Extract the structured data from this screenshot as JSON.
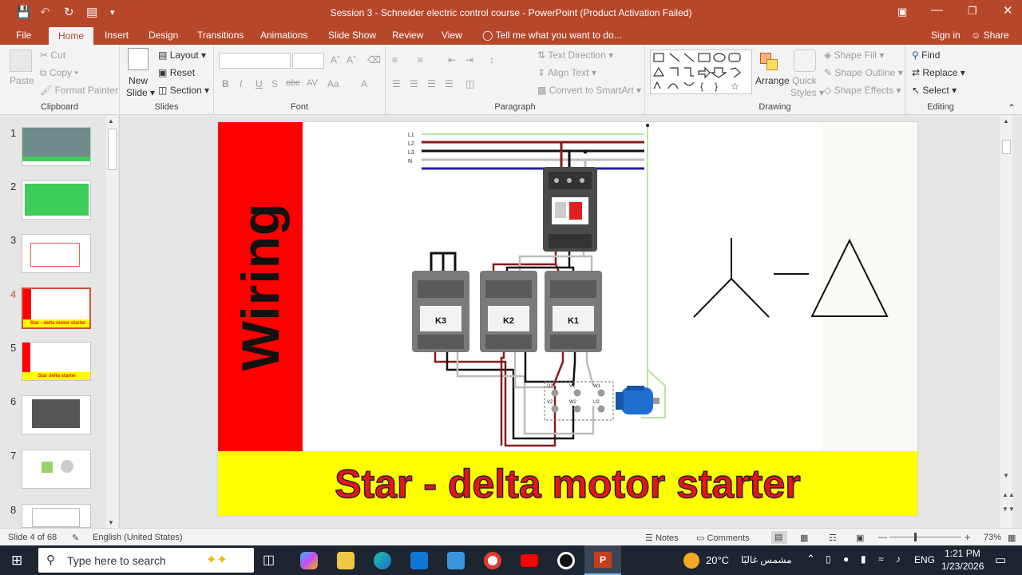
{
  "window": {
    "title": "Session 3 - Schneider electric control course - PowerPoint (Product Activation Failed)"
  },
  "tabs": [
    "File",
    "Home",
    "Insert",
    "Design",
    "Transitions",
    "Animations",
    "Slide Show",
    "Review",
    "View"
  ],
  "tell_me": "Tell me what you want to do...",
  "account": {
    "signin": "Sign in",
    "share": "Share"
  },
  "ribbon": {
    "clipboard": {
      "label": "Clipboard",
      "paste": "Paste",
      "cut": "Cut",
      "copy": "Copy",
      "format_painter": "Format Painter"
    },
    "slides": {
      "label": "Slides",
      "new_slide_1": "New",
      "new_slide_2": "Slide",
      "layout": "Layout",
      "reset": "Reset",
      "section": "Section"
    },
    "font": {
      "label": "Font",
      "bold": "B",
      "italic": "I",
      "underline": "U",
      "shadow": "S",
      "strike": "abc",
      "spacing": "AV",
      "case": "Aa",
      "color": "A"
    },
    "paragraph": {
      "label": "Paragraph",
      "text_direction": "Text Direction",
      "align_text": "Align Text",
      "convert_smartart": "Convert to SmartArt"
    },
    "drawing": {
      "label": "Drawing",
      "arrange": "Arrange",
      "quick_styles_1": "Quick",
      "quick_styles_2": "Styles",
      "shape_fill": "Shape Fill",
      "shape_outline": "Shape Outline",
      "shape_effects": "Shape Effects"
    },
    "editing": {
      "label": "Editing",
      "find": "Find",
      "replace": "Replace",
      "select": "Select"
    }
  },
  "thumbnails": {
    "numbers": [
      "1",
      "2",
      "3",
      "4",
      "5",
      "6",
      "7",
      "8"
    ],
    "selected": "4",
    "slide4_caption": "Star - delta motor starter",
    "slide5_caption": "Star delta starter"
  },
  "slide": {
    "side_label": "Wiring",
    "banner": "Star - delta motor starter",
    "lines": [
      "L1",
      "L2",
      "L3",
      "N"
    ],
    "contactors": [
      "K3",
      "K2",
      "K1"
    ],
    "terminals": [
      "U1",
      "V1",
      "W1",
      "V2",
      "W2",
      "U2"
    ]
  },
  "status": {
    "slide_count": "Slide 4 of 68",
    "language": "English (United States)",
    "notes": "Notes",
    "comments": "Comments",
    "zoom": "73%"
  },
  "taskbar": {
    "search_placeholder": "Type here to search",
    "weather_temp": "20°C",
    "weather_desc": "مشمس غالبًا",
    "lang": "ENG",
    "time": "1:21 PM",
    "date": "1/23/2026"
  },
  "colors": {
    "accent": "#b7472a",
    "slide_red": "#ff0000",
    "banner_yellow": "#ffff00",
    "banner_text": "#e8141c"
  }
}
